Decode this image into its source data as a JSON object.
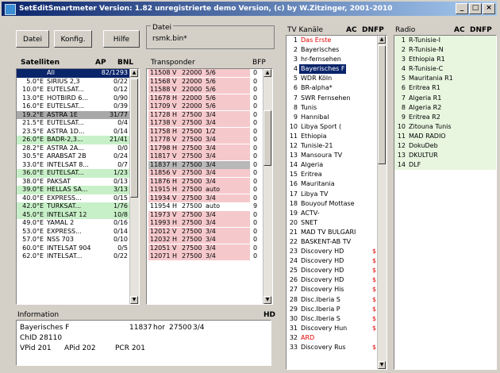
{
  "window": {
    "title": "SetEditSmartmeter Version: 1.82 unregistrierte demo Version, (c) by W.Zitzinger, 2001-2010",
    "min": "_",
    "max": "□",
    "close": "×"
  },
  "toolbar": {
    "datei": "Datei",
    "konfig": "Konfig.",
    "hilfe": "Hilfe"
  },
  "file": {
    "label": "Datei",
    "value": "rsmk.bin*"
  },
  "sat": {
    "header": {
      "name": "Satelliten",
      "ap": "AP",
      "bn": "BNL"
    },
    "rows": [
      {
        "pos": "",
        "name": "All",
        "cnt": "82/1293",
        "cls": "sat-sel"
      },
      {
        "pos": "5.0°E",
        "name": "SIRIUS 2,3",
        "cnt": "0/22",
        "cls": ""
      },
      {
        "pos": "10.0°E",
        "name": "EUTELSAT...",
        "cnt": "0/12",
        "cls": ""
      },
      {
        "pos": "13.0°E",
        "name": "HOTBIRD 6...",
        "cnt": "0/90",
        "cls": ""
      },
      {
        "pos": "16.0°E",
        "name": "EUTELSAT...",
        "cnt": "0/39",
        "cls": ""
      },
      {
        "pos": "19.2°E",
        "name": "ASTRA 1E",
        "cnt": "31/77",
        "cls": "sat-gry"
      },
      {
        "pos": "21.5°E",
        "name": "EUTELSAT...",
        "cnt": "0/4",
        "cls": ""
      },
      {
        "pos": "23.5°E",
        "name": "ASTRA 1D...",
        "cnt": "0/14",
        "cls": ""
      },
      {
        "pos": "26.0°E",
        "name": "BADR-2,3...",
        "cnt": "21/41",
        "cls": "sat-grn"
      },
      {
        "pos": "28.2°E",
        "name": "ASTRA 2A...",
        "cnt": "0/0",
        "cls": ""
      },
      {
        "pos": "30.5°E",
        "name": "ARABSAT 2B",
        "cnt": "0/24",
        "cls": ""
      },
      {
        "pos": "33.0°E",
        "name": "INTELSAT 8...",
        "cnt": "0/7",
        "cls": ""
      },
      {
        "pos": "36.0°E",
        "name": "EUTELSAT...",
        "cnt": "1/23",
        "cls": "sat-grn"
      },
      {
        "pos": "38.0°E",
        "name": "PAKSAT",
        "cnt": "0/13",
        "cls": ""
      },
      {
        "pos": "39.0°E",
        "name": "HELLAS SA...",
        "cnt": "3/13",
        "cls": "sat-grn"
      },
      {
        "pos": "40.0°E",
        "name": "EXPRESS...",
        "cnt": "0/15",
        "cls": ""
      },
      {
        "pos": "42.0°E",
        "name": "TURKSAT...",
        "cnt": "1/76",
        "cls": "sat-grn"
      },
      {
        "pos": "45.0°E",
        "name": "INTELSAT 12",
        "cnt": "10/8",
        "cls": "sat-grn"
      },
      {
        "pos": "49.0°E",
        "name": "YAMAL 2",
        "cnt": "0/16",
        "cls": ""
      },
      {
        "pos": "53.0°E",
        "name": "EXPRESS...",
        "cnt": "0/14",
        "cls": ""
      },
      {
        "pos": "57.0°E",
        "name": "NSS 703",
        "cnt": "0/10",
        "cls": ""
      },
      {
        "pos": "60.0°E",
        "name": "INTELSAT 904",
        "cnt": "0/5",
        "cls": ""
      },
      {
        "pos": "62.0°E",
        "name": "INTELSAT...",
        "cnt": "0/22",
        "cls": ""
      }
    ]
  },
  "tp": {
    "header": {
      "name": "Transponder",
      "bfp": "BFP"
    },
    "rows": [
      {
        "f": "11508",
        "p": "V",
        "sr": "22000",
        "fec": "5/6",
        "n": "0",
        "cls": "tp-red"
      },
      {
        "f": "11568",
        "p": "V",
        "sr": "22000",
        "fec": "5/6",
        "n": "0",
        "cls": "tp-red"
      },
      {
        "f": "11588",
        "p": "V",
        "sr": "22000",
        "fec": "5/6",
        "n": "0",
        "cls": "tp-red"
      },
      {
        "f": "11678",
        "p": "H",
        "sr": "22000",
        "fec": "5/6",
        "n": "0",
        "cls": "tp-red"
      },
      {
        "f": "11709",
        "p": "V",
        "sr": "22000",
        "fec": "5/6",
        "n": "0",
        "cls": "tp-red"
      },
      {
        "f": "11728",
        "p": "H",
        "sr": "27500",
        "fec": "3/4",
        "n": "0",
        "cls": "tp-red"
      },
      {
        "f": "11738",
        "p": "V",
        "sr": "27500",
        "fec": "3/4",
        "n": "0",
        "cls": "tp-red"
      },
      {
        "f": "11758",
        "p": "H",
        "sr": "27500",
        "fec": "1/2",
        "n": "0",
        "cls": "tp-red"
      },
      {
        "f": "11778",
        "p": "V",
        "sr": "27500",
        "fec": "3/4",
        "n": "0",
        "cls": "tp-red"
      },
      {
        "f": "11798",
        "p": "H",
        "sr": "27500",
        "fec": "3/4",
        "n": "0",
        "cls": "tp-red"
      },
      {
        "f": "11817",
        "p": "V",
        "sr": "27500",
        "fec": "3/4",
        "n": "0",
        "cls": "tp-red"
      },
      {
        "f": "11837",
        "p": "H",
        "sr": "27500",
        "fec": "3/4",
        "n": "0",
        "cls": "tp-gry"
      },
      {
        "f": "11856",
        "p": "V",
        "sr": "27500",
        "fec": "3/4",
        "n": "0",
        "cls": "tp-red"
      },
      {
        "f": "11876",
        "p": "H",
        "sr": "27500",
        "fec": "3/4",
        "n": "0",
        "cls": "tp-red"
      },
      {
        "f": "11915",
        "p": "H",
        "sr": "27500",
        "fec": "auto",
        "n": "0",
        "cls": "tp-red"
      },
      {
        "f": "11934",
        "p": "V",
        "sr": "27500",
        "fec": "3/4",
        "n": "0",
        "cls": "tp-red"
      },
      {
        "f": "11954",
        "p": "H",
        "sr": "27500",
        "fec": "auto",
        "n": "9",
        "cls": "tp-wht"
      },
      {
        "f": "11973",
        "p": "V",
        "sr": "27500",
        "fec": "3/4",
        "n": "0",
        "cls": "tp-red"
      },
      {
        "f": "11993",
        "p": "H",
        "sr": "27500",
        "fec": "3/4",
        "n": "0",
        "cls": "tp-red"
      },
      {
        "f": "12012",
        "p": "V",
        "sr": "27500",
        "fec": "3/4",
        "n": "0",
        "cls": "tp-red"
      },
      {
        "f": "12032",
        "p": "H",
        "sr": "27500",
        "fec": "3/4",
        "n": "0",
        "cls": "tp-red"
      },
      {
        "f": "12051",
        "p": "V",
        "sr": "27500",
        "fec": "3/4",
        "n": "0",
        "cls": "tp-red"
      },
      {
        "f": "12071",
        "p": "H",
        "sr": "27500",
        "fec": "3/4",
        "n": "0",
        "cls": "tp-red"
      }
    ]
  },
  "tv": {
    "header": {
      "name": "TV Kanäle",
      "ac": "AC",
      "dnfp": "DNFP"
    },
    "rows": [
      {
        "n": "1",
        "name": "Das Erste",
        "cls": "red"
      },
      {
        "n": "2",
        "name": "Bayerisches",
        "cls": ""
      },
      {
        "n": "3",
        "name": "hr-fernsehen",
        "cls": ""
      },
      {
        "n": "4",
        "name": "Bayerisches F",
        "cls": "hl"
      },
      {
        "n": "5",
        "name": "WDR Köln",
        "cls": ""
      },
      {
        "n": "6",
        "name": "BR-alpha*",
        "cls": ""
      },
      {
        "n": "7",
        "name": "SWR Fernsehen",
        "cls": ""
      },
      {
        "n": "8",
        "name": "Tunis",
        "cls": ""
      },
      {
        "n": "9",
        "name": "Hannibal",
        "cls": ""
      },
      {
        "n": "10",
        "name": "Libya Sport (",
        "cls": ""
      },
      {
        "n": "11",
        "name": "Ethiopia",
        "cls": ""
      },
      {
        "n": "12",
        "name": "Tunisie-21",
        "cls": ""
      },
      {
        "n": "13",
        "name": "Mansoura TV",
        "cls": ""
      },
      {
        "n": "14",
        "name": "Algeria",
        "cls": ""
      },
      {
        "n": "15",
        "name": "Eritrea",
        "cls": ""
      },
      {
        "n": "16",
        "name": "Mauritania",
        "cls": ""
      },
      {
        "n": "17",
        "name": "Libya TV",
        "cls": ""
      },
      {
        "n": "18",
        "name": "Bouyouf Mottase",
        "cls": ""
      },
      {
        "n": "19",
        "name": "ACTV-",
        "cls": ""
      },
      {
        "n": "20",
        "name": "SNET",
        "cls": ""
      },
      {
        "n": "21",
        "name": "MAD TV BULGARI",
        "cls": ""
      },
      {
        "n": "22",
        "name": "BASKENT-AB TV",
        "cls": ""
      },
      {
        "n": "23",
        "name": "Discovery HD",
        "cls": "",
        "mark": "$"
      },
      {
        "n": "24",
        "name": "Discovery HD",
        "cls": "",
        "mark": "$"
      },
      {
        "n": "25",
        "name": "Discovery HD",
        "cls": "",
        "mark": "$"
      },
      {
        "n": "26",
        "name": "Discovery HD",
        "cls": "",
        "mark": "$"
      },
      {
        "n": "27",
        "name": "Discovery His",
        "cls": "",
        "mark": "$"
      },
      {
        "n": "28",
        "name": "Disc.Iberia S",
        "cls": "",
        "mark": "$"
      },
      {
        "n": "29",
        "name": "Disc.Iberia P",
        "cls": "",
        "mark": "$"
      },
      {
        "n": "30",
        "name": "Disc.Iberia S",
        "cls": "",
        "mark": "$"
      },
      {
        "n": "31",
        "name": "Discovery Hun",
        "cls": "",
        "mark": "$"
      },
      {
        "n": "32",
        "name": "ARD",
        "cls": "red"
      },
      {
        "n": "33",
        "name": "Discovery Rus",
        "cls": "",
        "mark": "$"
      }
    ]
  },
  "radio": {
    "header": {
      "name": "Radio",
      "ac": "AC",
      "dnfp": "DNFP"
    },
    "rows": [
      {
        "n": "1",
        "name": "R-Tunisie-I",
        "cls": ""
      },
      {
        "n": "2",
        "name": "R-Tunisie-N",
        "cls": ""
      },
      {
        "n": "3",
        "name": "Ethiopia R1",
        "cls": ""
      },
      {
        "n": "4",
        "name": "R-Tunisie-C",
        "cls": ""
      },
      {
        "n": "5",
        "name": "Mauritania R1",
        "cls": ""
      },
      {
        "n": "6",
        "name": "Eritrea R1",
        "cls": ""
      },
      {
        "n": "7",
        "name": "Algeria R1",
        "cls": ""
      },
      {
        "n": "8",
        "name": "Algeria R2",
        "cls": ""
      },
      {
        "n": "9",
        "name": "Eritrea R2",
        "cls": ""
      },
      {
        "n": "10",
        "name": "Zitouna Tunis",
        "cls": ""
      },
      {
        "n": "11",
        "name": "MAD RADIO",
        "cls": ""
      },
      {
        "n": "12",
        "name": "DokuDeb",
        "cls": ""
      },
      {
        "n": "13",
        "name": "DKULTUR",
        "cls": ""
      },
      {
        "n": "14",
        "name": "DLF",
        "cls": ""
      }
    ]
  },
  "info": {
    "title": "Information",
    "hd": "HD",
    "name": "Bayerisches F",
    "freq": "11837",
    "pol": "hor",
    "sr": "27500",
    "fec": "3/4",
    "chid": "ChID 28110",
    "vpid": "VPid 201",
    "apid": "APid 202",
    "pcr": "PCR 201"
  }
}
